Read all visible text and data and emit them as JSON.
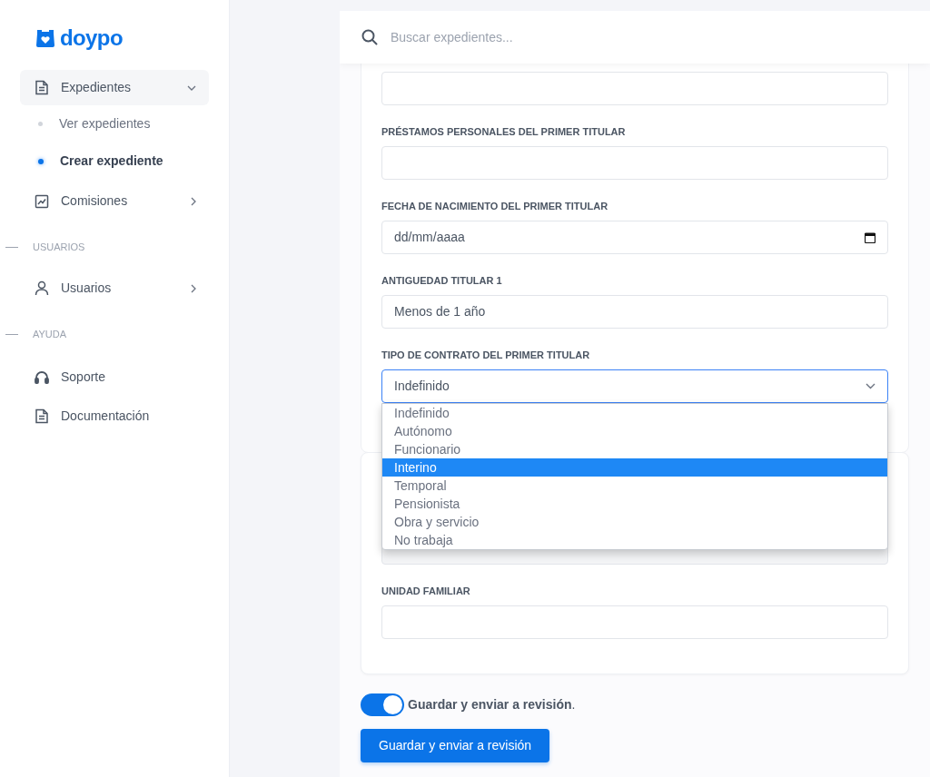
{
  "sidebar": {
    "logo": "doypo",
    "items": [
      {
        "kind": "item",
        "label": "Expedientes",
        "expanded": true,
        "children": [
          {
            "label": "Ver expedientes",
            "selected": false
          },
          {
            "label": "Crear expediente",
            "selected": true
          }
        ]
      },
      {
        "kind": "item",
        "label": "Comisiones",
        "expanded": false
      },
      {
        "kind": "section",
        "label": "USUARIOS"
      },
      {
        "kind": "item",
        "label": "Usuarios",
        "expanded": false
      },
      {
        "kind": "section",
        "label": "AYUDA"
      },
      {
        "kind": "link",
        "label": "Soporte"
      },
      {
        "kind": "link",
        "label": "Documentación"
      }
    ]
  },
  "search": {
    "placeholder": "Buscar expedientes..."
  },
  "form": {
    "fields": [
      {
        "kind": "text"
      },
      {
        "kind": "text",
        "label": "PRÉSTAMOS PERSONALES DEL PRIMER TITULAR"
      },
      {
        "kind": "date",
        "label": "FECHA DE NACIMIENTO DEL PRIMER TITULAR",
        "value": "dd/mm/aaaa"
      },
      {
        "kind": "text",
        "label": "ANTIGUEDAD TITULAR 1",
        "value": "Menos de 1 año"
      },
      {
        "kind": "select",
        "label": "TIPO DE CONTRATO DEL PRIMER TITULAR",
        "value": "Indefinido",
        "open": true,
        "options": [
          {
            "label": "Indefinido",
            "highlighted": false
          },
          {
            "label": "Autónomo",
            "highlighted": false
          },
          {
            "label": "Funcionario",
            "highlighted": false
          },
          {
            "label": "Interino",
            "highlighted": true
          },
          {
            "label": "Temporal",
            "highlighted": false
          },
          {
            "label": "Pensionista",
            "highlighted": false
          },
          {
            "label": "Obra y servicio",
            "highlighted": false
          },
          {
            "label": "No trabaja",
            "highlighted": false
          }
        ]
      }
    ]
  },
  "form2": {
    "fields": [
      {
        "kind": "text",
        "disabled": true
      },
      {
        "kind": "text",
        "label": "UNIDAD FAMILIAR"
      }
    ]
  },
  "toggle": {
    "on": true,
    "label": "**Guardar y enviar a revisión**."
  },
  "submit_button": "Guardar y enviar a revisión"
}
